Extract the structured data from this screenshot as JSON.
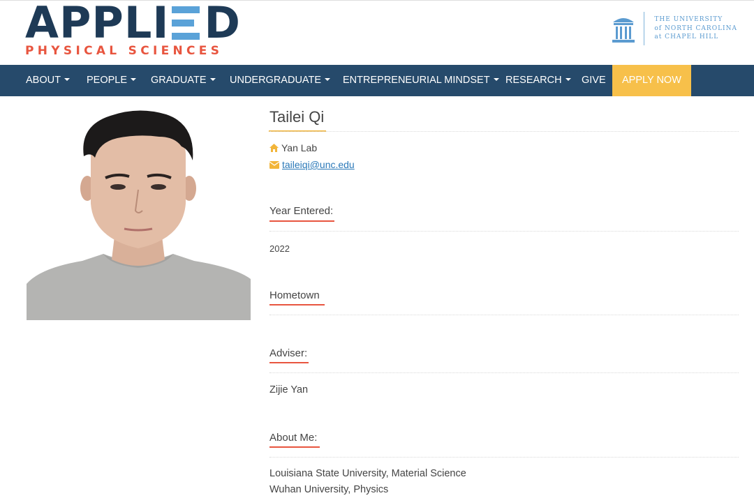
{
  "header": {
    "logo_main_left": "APPL",
    "logo_main_i": "I",
    "logo_main_right": "D",
    "logo_sub": "PHYSICAL SCIENCES",
    "university_line1": "THE UNIVERSITY",
    "university_line2": "of NORTH CAROLINA",
    "university_line3": "at CHAPEL HILL"
  },
  "nav": {
    "items": [
      {
        "label": "ABOUT",
        "has_caret": true
      },
      {
        "label": "PEOPLE",
        "has_caret": true
      },
      {
        "label": "GRADUATE",
        "has_caret": true
      },
      {
        "label": "UNDERGRADUATE",
        "has_caret": true
      },
      {
        "label": "ENTREPRENEURIAL MINDSET",
        "has_caret": true
      },
      {
        "label": "RESEARCH",
        "has_caret": true
      },
      {
        "label": "GIVE",
        "has_caret": false
      }
    ],
    "apply_label": "APPLY NOW"
  },
  "profile": {
    "name": "Tailei Qi",
    "lab": "Yan Lab",
    "email": " taileiqi@unc.edu",
    "home_icon": "home-icon",
    "email_icon": "envelope-icon"
  },
  "sections": {
    "year_entered_title": "Year Entered:",
    "year_entered_value": "2022",
    "hometown_title": "Hometown",
    "adviser_title": "Adviser:",
    "adviser_value": "Zijie Yan",
    "about_title": "About Me:",
    "about_lines": [
      "Louisiana State University, Material Science",
      "Wuhan University, Physics"
    ]
  },
  "colors": {
    "nav_bg": "#264a6b",
    "apply_bg": "#f7c04a",
    "accent_orange": "#f2b53a",
    "accent_red": "#e8553f",
    "logo_blue": "#1e3a56",
    "link_blue": "#2a78b8"
  }
}
